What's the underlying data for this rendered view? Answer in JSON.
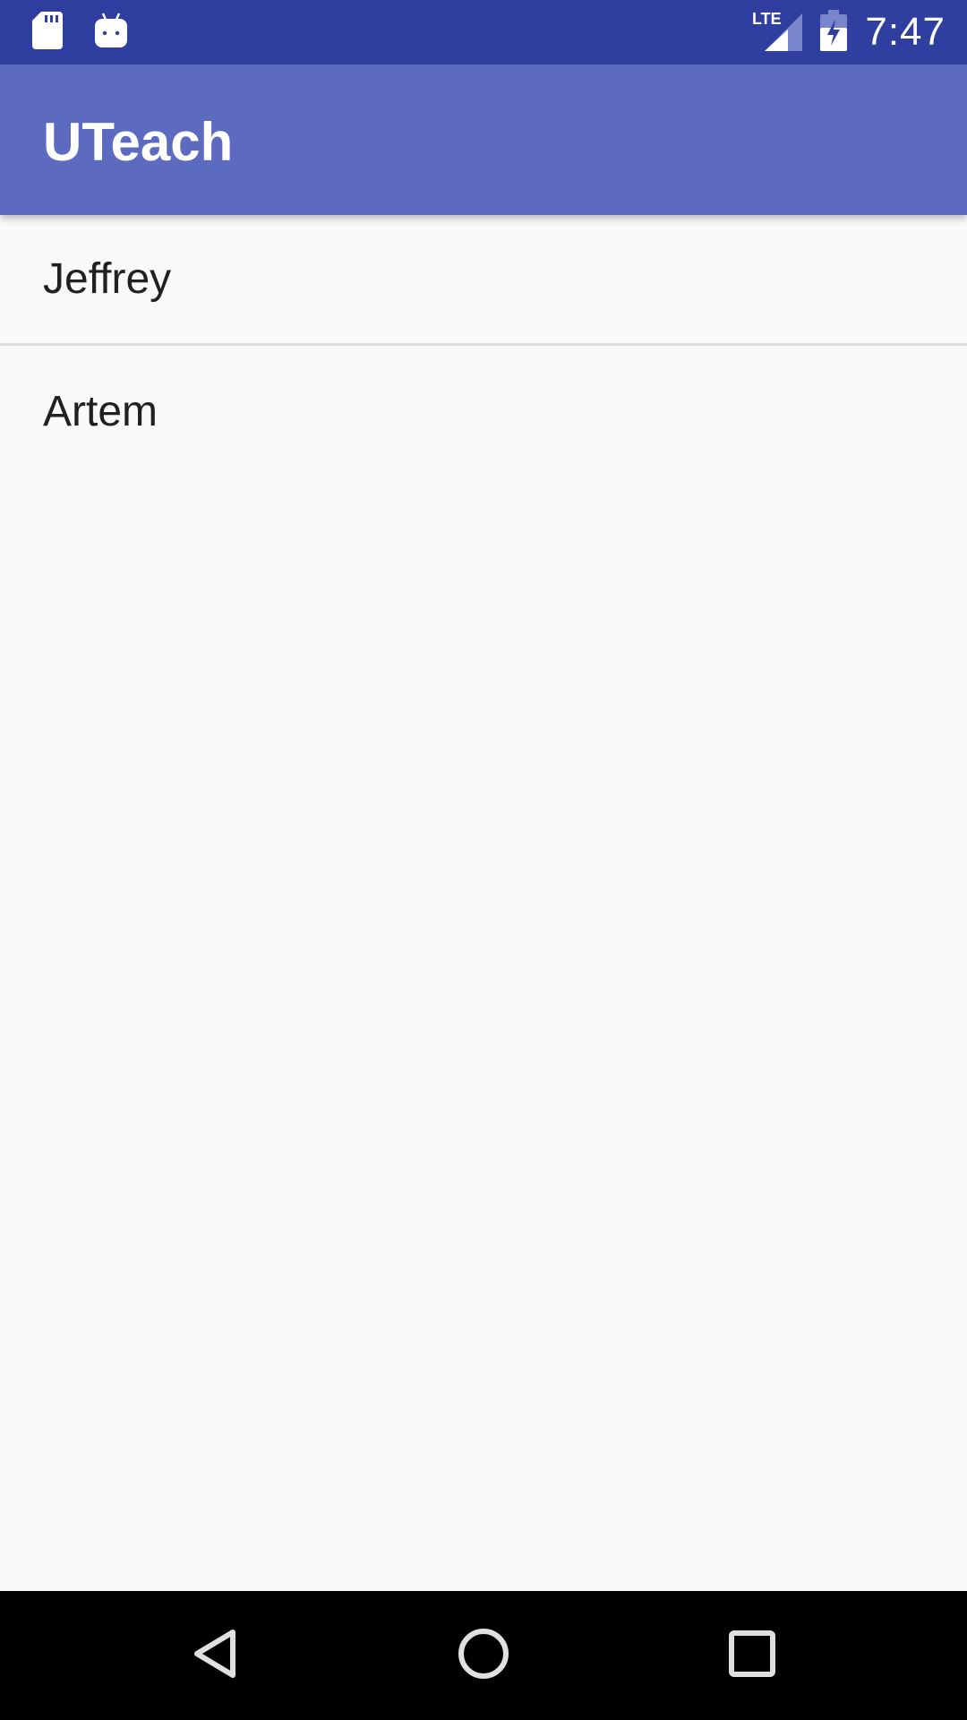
{
  "status_bar": {
    "time": "7:47",
    "network": "LTE",
    "icons": [
      "sd-card-icon",
      "android-debug-icon",
      "lte-signal-icon",
      "battery-charging-icon"
    ]
  },
  "app_bar": {
    "title": "UTeach",
    "color": "#5c6bc0"
  },
  "list": {
    "items": [
      {
        "label": "Jeffrey"
      },
      {
        "label": "Artem"
      }
    ]
  },
  "nav_bar": {
    "buttons": [
      "back-icon",
      "home-icon",
      "recents-icon"
    ]
  },
  "colors": {
    "status_bar": "#303f9f",
    "background": "#fafafa"
  }
}
